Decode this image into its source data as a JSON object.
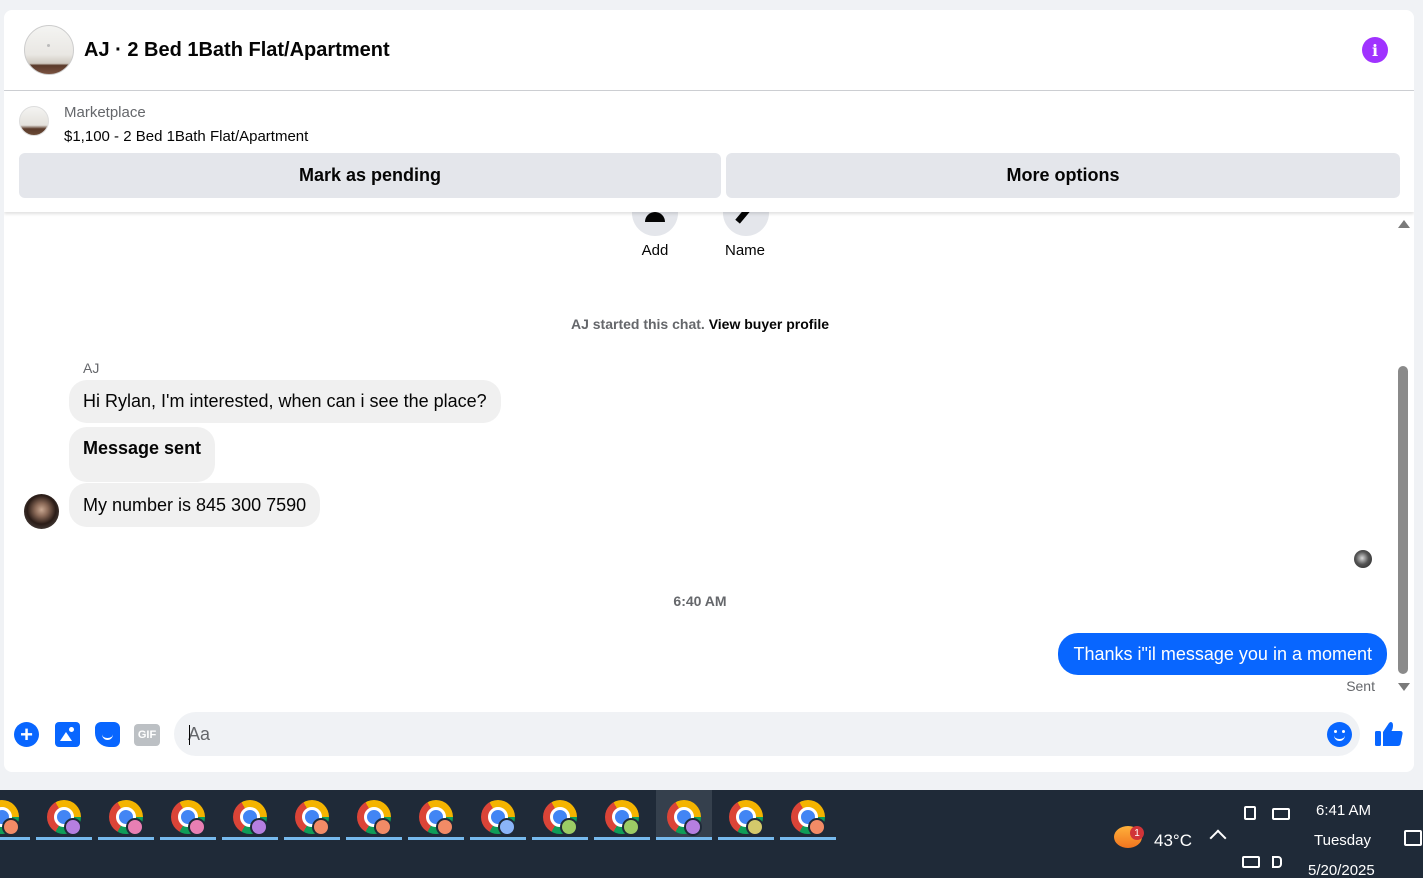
{
  "header": {
    "title": "AJ · 2 Bed 1Bath Flat/Apartment",
    "info_icon": "info-icon"
  },
  "marketplace": {
    "label": "Marketplace",
    "listing": "$1,100 - 2 Bed 1Bath Flat/Apartment",
    "mark_pending_label": "Mark as pending",
    "more_options_label": "More options"
  },
  "actions": {
    "add_label": "Add",
    "name_label": "Name"
  },
  "chat": {
    "system_text": "AJ started this chat.",
    "system_link": "View buyer profile",
    "sender_name": "AJ",
    "incoming": [
      "Hi Rylan, I'm interested, when can i see the  place?",
      "Message sent",
      "My number is 845 300 7590"
    ],
    "timestamp": "6:40 AM",
    "outgoing": "Thanks i\"il message you in a moment",
    "outgoing_status": "Sent"
  },
  "composer": {
    "placeholder": "Aa",
    "icons": [
      "plus-icon",
      "photo-icon",
      "sticker-icon",
      "gif-icon",
      "emoji-icon",
      "like-icon"
    ],
    "gif_label": "GIF"
  },
  "taskbar": {
    "chrome_badge_colors": [
      "#f28b66",
      "#b57fe0",
      "#e87fb3",
      "#e87fb3",
      "#b57fe0",
      "#f28b66",
      "#f28b66",
      "#f28b66",
      "#8ab4f8",
      "#9ccc65",
      "#9ccc65",
      "#b57fe0",
      "#d4c96b",
      "#f28b66"
    ],
    "active_index": 11,
    "weather_badge": "1",
    "temperature": "43°C",
    "time": "6:41 AM",
    "day": "Tuesday",
    "date": "5/20/2025"
  },
  "colors": {
    "accent": "#0866ff",
    "info": "#a033ff",
    "taskbar": "#1f2a38"
  }
}
